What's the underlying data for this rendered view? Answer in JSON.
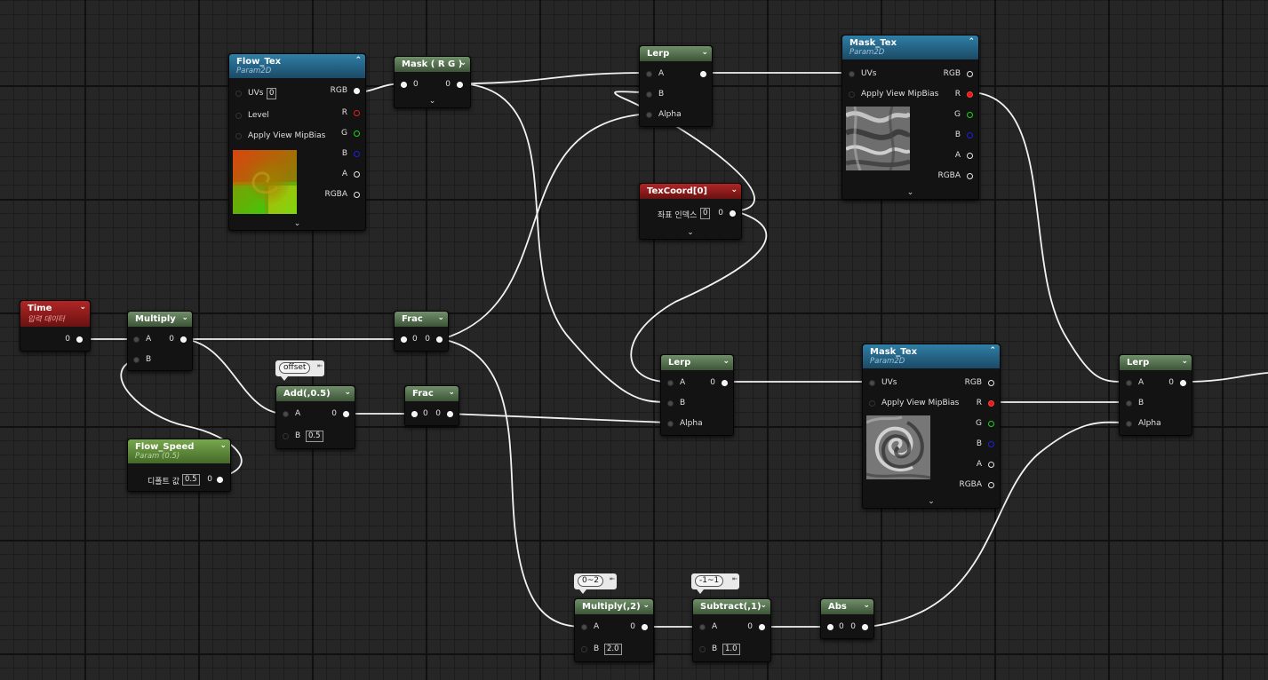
{
  "nodes": {
    "time": {
      "title": "Time",
      "subtitle": "입력 데이터",
      "out_label": "0"
    },
    "multiply": {
      "title": "Multiply",
      "a_label": "A",
      "b_label": "B",
      "out_label": "0"
    },
    "flow_speed": {
      "title": "Flow_Speed",
      "subtitle": "Param (0.5)",
      "default_label": "디폴트 값",
      "default_value": "0.5",
      "out_label": "0"
    },
    "flow_tex": {
      "title": "Flow_Tex",
      "subtitle": "Param2D",
      "uvs_label": "UVs",
      "uvs_value": "0",
      "level_label": "Level",
      "mip_label": "Apply View MipBias",
      "outputs": [
        "RGB",
        "R",
        "G",
        "B",
        "A",
        "RGBA"
      ]
    },
    "mask_rg": {
      "title": "Mask ( R G )",
      "in_label": "0",
      "out_label": "0"
    },
    "add": {
      "title": "Add(,0.5)",
      "comment": "offset",
      "a_label": "A",
      "b_label": "B",
      "b_value": "0.5",
      "out_label": "0"
    },
    "frac1": {
      "title": "Frac",
      "in_label": "0",
      "out_label": "0"
    },
    "frac2": {
      "title": "Frac",
      "in_label": "0",
      "out_label": "0"
    },
    "lerp1": {
      "title": "Lerp",
      "a_label": "A",
      "b_label": "B",
      "alpha_label": "Alpha"
    },
    "texcoord": {
      "title": "TexCoord[0]",
      "index_label": "좌표 인덱스",
      "index_value": "0",
      "out_label": "0"
    },
    "mask_tex1": {
      "title": "Mask_Tex",
      "subtitle": "Param2D",
      "uvs_label": "UVs",
      "mip_label": "Apply View MipBias",
      "outputs": [
        "RGB",
        "R",
        "G",
        "B",
        "A",
        "RGBA"
      ]
    },
    "lerp2": {
      "title": "Lerp",
      "a_label": "A",
      "b_label": "B",
      "alpha_label": "Alpha",
      "out_label": "0"
    },
    "mask_tex2": {
      "title": "Mask_Tex",
      "subtitle": "Param2D",
      "uvs_label": "UVs",
      "mip_label": "Apply View MipBias",
      "outputs": [
        "RGB",
        "R",
        "G",
        "B",
        "A",
        "RGBA"
      ]
    },
    "lerp3": {
      "title": "Lerp",
      "a_label": "A",
      "b_label": "B",
      "alpha_label": "Alpha",
      "out_label": "0"
    },
    "multiply2": {
      "title": "Multiply(,2)",
      "comment": "0~2",
      "a_label": "A",
      "b_label": "B",
      "b_value": "2.0",
      "out_label": "0"
    },
    "subtract": {
      "title": "Subtract(,1)",
      "comment": "-1~1",
      "a_label": "A",
      "b_label": "B",
      "b_value": "1.0",
      "out_label": "0"
    },
    "abs": {
      "title": "Abs",
      "in_label": "0",
      "out_label": "0"
    }
  },
  "colors": {
    "wire": "#ffffff",
    "pin_r": "#e51a1a",
    "pin_g": "#20d020",
    "pin_b": "#2020e0",
    "header_green": "#5a7a52",
    "header_blue": "#2a6f94",
    "header_red": "#9c1f1f"
  },
  "icons": {
    "collapse": "chevron-down-icon",
    "expand_up": "chevron-up-icon",
    "pin": "pin-icon"
  }
}
